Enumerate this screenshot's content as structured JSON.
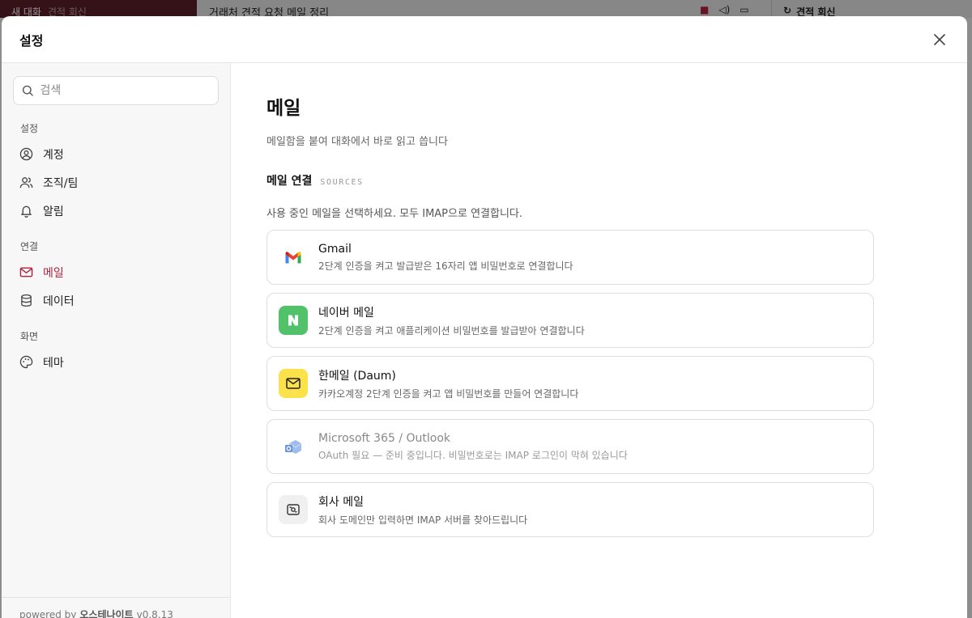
{
  "background": {
    "sidebar_new_chat": "새 대화",
    "sidebar_muted": "견적 회신",
    "chat_title": "거래처 견적 요청 메일 정리",
    "right_panel_title": "견적 회신"
  },
  "modal": {
    "title": "설정",
    "close_icon": "close-icon"
  },
  "sidebar": {
    "search_placeholder": "검색",
    "sections": [
      {
        "label": "설정",
        "items": [
          {
            "label": "계정",
            "icon": "user-circle-icon"
          },
          {
            "label": "조직/팀",
            "icon": "users-icon"
          },
          {
            "label": "알림",
            "icon": "bell-icon"
          }
        ]
      },
      {
        "label": "연결",
        "items": [
          {
            "label": "메일",
            "icon": "mail-icon",
            "active": true
          },
          {
            "label": "데이터",
            "icon": "database-icon"
          }
        ]
      },
      {
        "label": "화면",
        "items": [
          {
            "label": "테마",
            "icon": "palette-icon"
          }
        ]
      }
    ],
    "footer": {
      "powered": "powered by",
      "brand": "오스테나이트",
      "version": "v0.8.13"
    }
  },
  "content": {
    "title": "메일",
    "description": "메일함을 붙여 대화에서 바로 읽고 씁니다",
    "section_title": "메일 연결",
    "section_tag": "SOURCES",
    "hint": "사용 중인 메일을 선택하세요. 모두 IMAP으로 연결합니다.",
    "providers": [
      {
        "name": "Gmail",
        "sub": "2단계 인증을 켜고 발급받은 16자리 앱 비밀번호로 연결합니다",
        "icon": "gmail-icon"
      },
      {
        "name": "네이버 메일",
        "sub": "2단계 인증을 켜고 애플리케이션 비밀번호를 발급받아 연결합니다",
        "icon": "naver-icon"
      },
      {
        "name": "한메일 (Daum)",
        "sub": "카카오계정 2단계 인증을 켜고 앱 비밀번호를 만들어 연결합니다",
        "icon": "daum-mail-icon"
      },
      {
        "name": "Microsoft 365 / Outlook",
        "sub": "OAuth 필요 — 준비 중입니다. 비밀번호로는 IMAP 로그인이 막혀 있습니다",
        "icon": "outlook-icon",
        "disabled": true
      },
      {
        "name": "회사 메일",
        "sub": "회사 도메인만 입력하면 IMAP 서버를 찾아드립니다",
        "icon": "company-mail-icon"
      }
    ]
  },
  "colors": {
    "accent": "#b4213e",
    "naver": "#03c75a",
    "daum": "#ffe14d"
  }
}
